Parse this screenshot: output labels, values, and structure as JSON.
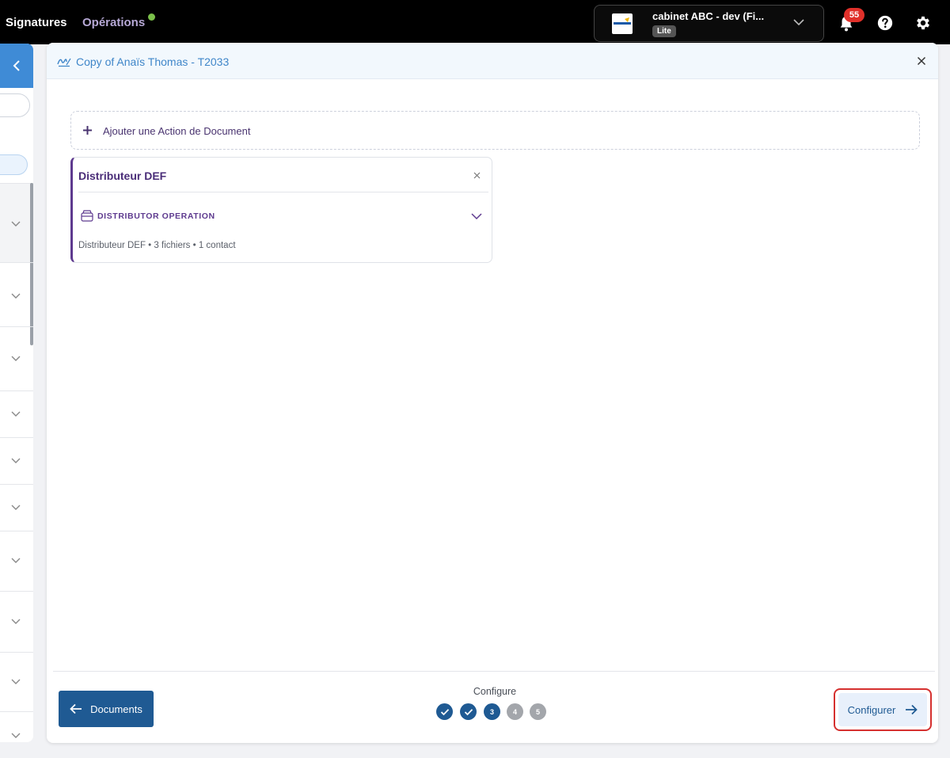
{
  "topbar": {
    "nav": [
      {
        "label": "Signatures"
      },
      {
        "label": "Opérations",
        "status_color": "#7bc04a"
      }
    ],
    "organization": {
      "name": "cabinet ABC - dev (Fi...",
      "plan_badge": "Lite",
      "logo_icon": "organization-logo-icon"
    },
    "notifications": {
      "count": "55",
      "icon": "bell-icon"
    },
    "help_icon": "help-icon",
    "settings_icon": "gear-icon"
  },
  "modal": {
    "title": "Copy of Anaïs Thomas - T2033",
    "title_icon": "signature-icon",
    "close_icon": "close-icon",
    "add_action": {
      "label": "Ajouter une Action de Document",
      "icon": "plus-icon"
    },
    "cards": [
      {
        "title": "Distributeur DEF",
        "operation_label": "DISTRIBUTOR OPERATION",
        "operation_icon": "tray-icon",
        "meta": "Distributeur DEF • 3 fichiers • 1 contact"
      }
    ],
    "footer": {
      "back_button": {
        "label": "Documents",
        "icon": "arrow-left-icon"
      },
      "stepper": {
        "label": "Configure",
        "steps": [
          {
            "label": "",
            "state": "done"
          },
          {
            "label": "",
            "state": "done"
          },
          {
            "label": "3",
            "state": "current"
          },
          {
            "label": "4",
            "state": "todo"
          },
          {
            "label": "5",
            "state": "todo"
          }
        ]
      },
      "next_button": {
        "label": "Configurer",
        "icon": "arrow-right-icon"
      }
    }
  },
  "colors": {
    "primary": "#1f5a93",
    "accent_purple": "#5e3a8f",
    "link_blue": "#3f86c9",
    "highlight_red": "#d5302f"
  }
}
